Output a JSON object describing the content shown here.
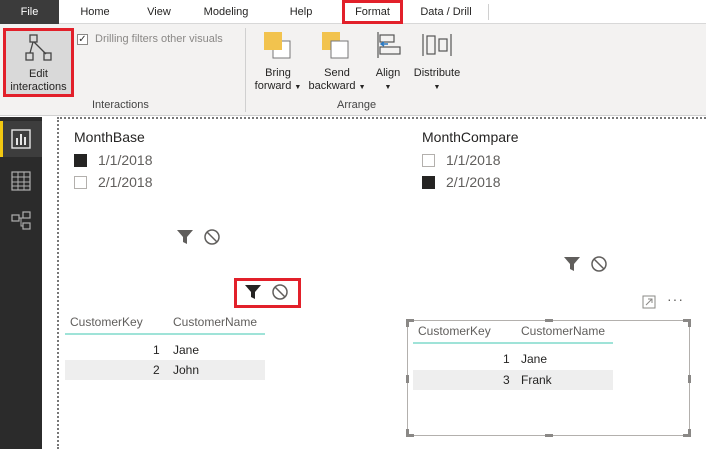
{
  "tabs": {
    "file": "File",
    "home": "Home",
    "view": "View",
    "modeling": "Modeling",
    "help": "Help",
    "format": "Format",
    "data_drill": "Data / Drill"
  },
  "ribbon": {
    "edit_interactions_line1": "Edit",
    "edit_interactions_line2": "interactions",
    "drilling_filters": "Drilling filters other visuals",
    "interactions_group": "Interactions",
    "bring_forward_line1": "Bring",
    "bring_forward_line2": "forward",
    "send_backward_line1": "Send",
    "send_backward_line2": "backward",
    "align": "Align",
    "distribute": "Distribute",
    "arrange_group": "Arrange"
  },
  "slicers": {
    "base": {
      "title": "MonthBase",
      "items": [
        {
          "label": "1/1/2018",
          "checked": true
        },
        {
          "label": "2/1/2018",
          "checked": false
        }
      ]
    },
    "compare": {
      "title": "MonthCompare",
      "items": [
        {
          "label": "1/1/2018",
          "checked": false
        },
        {
          "label": "2/1/2018",
          "checked": true
        }
      ]
    }
  },
  "tables": {
    "left": {
      "headers": [
        "CustomerKey",
        "CustomerName"
      ],
      "rows": [
        [
          "1",
          "Jane"
        ],
        [
          "2",
          "John"
        ]
      ]
    },
    "right": {
      "headers": [
        "CustomerKey",
        "CustomerName"
      ],
      "rows": [
        [
          "1",
          "Jane"
        ],
        [
          "3",
          "Frank"
        ]
      ]
    }
  },
  "visual_header": {
    "more_options": "···"
  },
  "colors": {
    "highlight": "#e2202a",
    "accent_yellow": "#f2c811",
    "table_underline": "#9fe3d8"
  },
  "icons": [
    "edit-interactions-icon",
    "bring-forward-icon",
    "send-backward-icon",
    "align-icon",
    "distribute-icon",
    "report-view-icon",
    "data-view-icon",
    "model-view-icon",
    "filter-icon",
    "none-icon",
    "focus-mode-icon"
  ]
}
